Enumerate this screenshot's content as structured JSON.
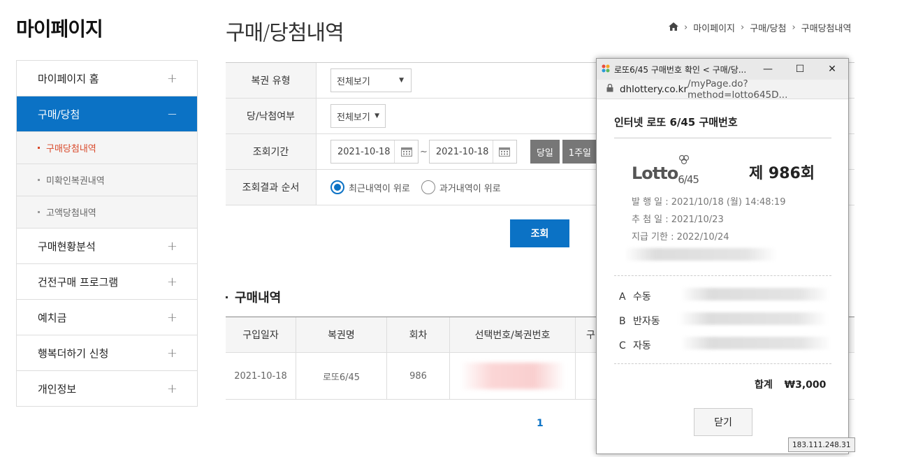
{
  "sidebar": {
    "title": "마이페이지",
    "items": [
      {
        "label": "마이페이지 홈",
        "toggle": "+"
      },
      {
        "label": "구매/당첨",
        "toggle": "−"
      },
      {
        "label": "구매현황분석",
        "toggle": "+"
      },
      {
        "label": "건전구매 프로그램",
        "toggle": "+"
      },
      {
        "label": "예치금",
        "toggle": "+"
      },
      {
        "label": "행복더하기 신청",
        "toggle": "+"
      },
      {
        "label": "개인정보",
        "toggle": "+"
      }
    ],
    "subitems": [
      "구매당첨내역",
      "미확인복권내역",
      "고액당첨내역"
    ]
  },
  "header": {
    "title": "구매/당첨내역",
    "breadcrumb": [
      "마이페이지",
      "구매/당첨",
      "구매당첨내역"
    ]
  },
  "filter": {
    "type_label": "복권 유형",
    "type_value": "전체보기",
    "win_label": "당/낙첨여부",
    "win_value": "전체보기",
    "period_label": "조회기간",
    "date_from": "2021-10-18",
    "date_to": "2021-10-18",
    "tilde": "~",
    "btn_today": "당일",
    "btn_week": "1주일",
    "order_label": "조회결과 순서",
    "order_recent": "최근내역이 위로",
    "order_past": "과거내역이 위로",
    "search_button": "조회"
  },
  "results": {
    "section_title": "구매내역",
    "headers": [
      "구입일자",
      "복권명",
      "회차",
      "선택번호/복권번호",
      "구"
    ],
    "row": {
      "date": "2021-10-18",
      "name": "로또6/45",
      "round": "986"
    },
    "page": "1"
  },
  "popup": {
    "window_title": "로또6/45 구매번호 확인 < 구매/당...",
    "addr_host": "dhlottery.co.kr",
    "addr_path": "/myPage.do?method=lotto645D...",
    "heading": "인터넷 로또 6/45 구매번호",
    "logo_main": "Lotto",
    "logo_sub": "6/45",
    "round": "제 986회",
    "issue": "발 행 일 : 2021/10/18 (월) 14:48:19",
    "draw": "추 첨 일 : 2021/10/23",
    "deadline": "지급 기한 : 2022/10/24",
    "games": [
      {
        "letter": "A",
        "mode": "수동"
      },
      {
        "letter": "B",
        "mode": "반자동"
      },
      {
        "letter": "C",
        "mode": "자동"
      }
    ],
    "total_label": "합계",
    "total_value": "₩3,000",
    "close_button": "닫기",
    "ip": "183.111.248.31"
  },
  "colors": {
    "accent": "#0b72c5",
    "active_sub": "#d94a2c"
  }
}
